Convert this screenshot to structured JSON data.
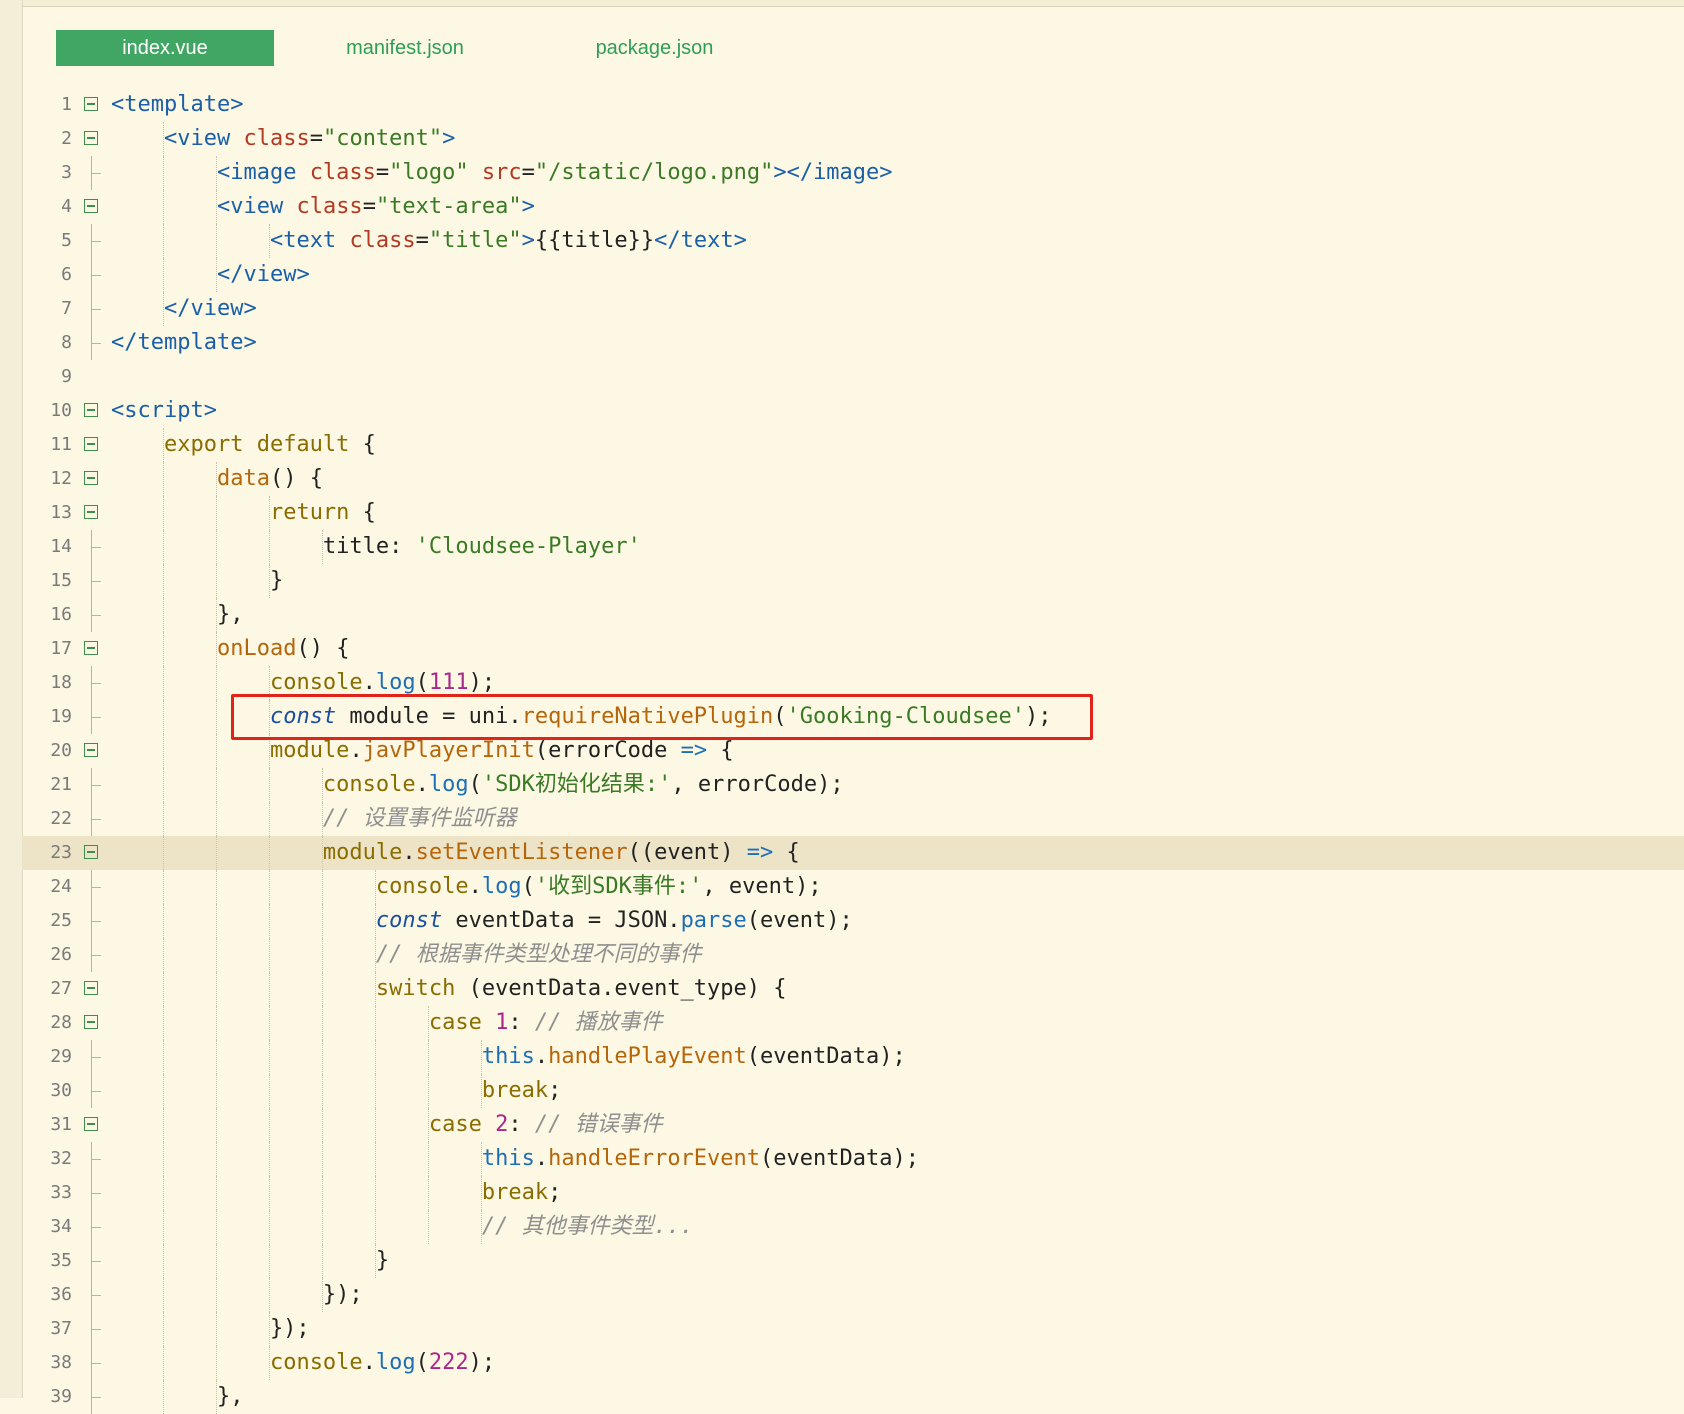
{
  "tabs": [
    {
      "label": "index.vue",
      "active": true
    },
    {
      "label": "manifest.json",
      "active": false
    },
    {
      "label": "package.json",
      "active": false
    }
  ],
  "current_line": 23,
  "highlighted_line": 19,
  "colors": {
    "accent": "#41a663",
    "highlight_box": "#e2231a",
    "background": "#fdf8e4"
  },
  "lines": [
    {
      "n": 1,
      "fold": true,
      "tokens": [
        {
          "c": "t",
          "v": "<template>"
        }
      ]
    },
    {
      "n": 2,
      "fold": true,
      "tokens": [
        {
          "c": "p",
          "v": "    "
        },
        {
          "c": "t",
          "v": "<view "
        },
        {
          "c": "a",
          "v": "class"
        },
        {
          "c": "p",
          "v": "="
        },
        {
          "c": "s",
          "v": "\"content\""
        },
        {
          "c": "t",
          "v": ">"
        }
      ]
    },
    {
      "n": 3,
      "fold": false,
      "tokens": [
        {
          "c": "p",
          "v": "        "
        },
        {
          "c": "t",
          "v": "<image "
        },
        {
          "c": "a",
          "v": "class"
        },
        {
          "c": "p",
          "v": "="
        },
        {
          "c": "s",
          "v": "\"logo\""
        },
        {
          "c": "p",
          "v": " "
        },
        {
          "c": "a",
          "v": "src"
        },
        {
          "c": "p",
          "v": "="
        },
        {
          "c": "s",
          "v": "\"/static/logo.png\""
        },
        {
          "c": "t",
          "v": "></image>"
        }
      ]
    },
    {
      "n": 4,
      "fold": true,
      "tokens": [
        {
          "c": "p",
          "v": "        "
        },
        {
          "c": "t",
          "v": "<view "
        },
        {
          "c": "a",
          "v": "class"
        },
        {
          "c": "p",
          "v": "="
        },
        {
          "c": "s",
          "v": "\"text-area\""
        },
        {
          "c": "t",
          "v": ">"
        }
      ]
    },
    {
      "n": 5,
      "fold": false,
      "tokens": [
        {
          "c": "p",
          "v": "            "
        },
        {
          "c": "t",
          "v": "<text "
        },
        {
          "c": "a",
          "v": "class"
        },
        {
          "c": "p",
          "v": "="
        },
        {
          "c": "s",
          "v": "\"title\""
        },
        {
          "c": "t",
          "v": ">"
        },
        {
          "c": "p",
          "v": "{{title}}"
        },
        {
          "c": "t",
          "v": "</text>"
        }
      ]
    },
    {
      "n": 6,
      "fold": false,
      "tokens": [
        {
          "c": "p",
          "v": "        "
        },
        {
          "c": "t",
          "v": "</view>"
        }
      ]
    },
    {
      "n": 7,
      "fold": false,
      "tokens": [
        {
          "c": "p",
          "v": "    "
        },
        {
          "c": "t",
          "v": "</view>"
        }
      ]
    },
    {
      "n": 8,
      "fold": false,
      "tokens": [
        {
          "c": "t",
          "v": "</template>"
        }
      ]
    },
    {
      "n": 9,
      "fold": false,
      "tokens": []
    },
    {
      "n": 10,
      "fold": true,
      "tokens": [
        {
          "c": "t",
          "v": "<script>"
        }
      ]
    },
    {
      "n": 11,
      "fold": true,
      "tokens": [
        {
          "c": "p",
          "v": "    "
        },
        {
          "c": "k",
          "v": "export default"
        },
        {
          "c": "p",
          "v": " {"
        }
      ]
    },
    {
      "n": 12,
      "fold": true,
      "tokens": [
        {
          "c": "p",
          "v": "        "
        },
        {
          "c": "fn",
          "v": "data"
        },
        {
          "c": "p",
          "v": "() {"
        }
      ]
    },
    {
      "n": 13,
      "fold": true,
      "tokens": [
        {
          "c": "p",
          "v": "            "
        },
        {
          "c": "k",
          "v": "return"
        },
        {
          "c": "p",
          "v": " {"
        }
      ]
    },
    {
      "n": 14,
      "fold": false,
      "tokens": [
        {
          "c": "p",
          "v": "                title: "
        },
        {
          "c": "s",
          "v": "'Cloudsee-Player'"
        }
      ]
    },
    {
      "n": 15,
      "fold": false,
      "tokens": [
        {
          "c": "p",
          "v": "            }"
        }
      ]
    },
    {
      "n": 16,
      "fold": false,
      "tokens": [
        {
          "c": "p",
          "v": "        },"
        }
      ]
    },
    {
      "n": 17,
      "fold": true,
      "tokens": [
        {
          "c": "p",
          "v": "        "
        },
        {
          "c": "fn",
          "v": "onLoad"
        },
        {
          "c": "p",
          "v": "() {"
        }
      ]
    },
    {
      "n": 18,
      "fold": false,
      "tokens": [
        {
          "c": "p",
          "v": "            "
        },
        {
          "c": "k",
          "v": "console"
        },
        {
          "c": "p",
          "v": "."
        },
        {
          "c": "m",
          "v": "log"
        },
        {
          "c": "p",
          "v": "("
        },
        {
          "c": "n",
          "v": "111"
        },
        {
          "c": "p",
          "v": ");"
        }
      ]
    },
    {
      "n": 19,
      "fold": false,
      "tokens": [
        {
          "c": "p",
          "v": "            "
        },
        {
          "c": "it",
          "v": "const"
        },
        {
          "c": "p",
          "v": " module = uni."
        },
        {
          "c": "fn",
          "v": "requireNativePlugin"
        },
        {
          "c": "p",
          "v": "("
        },
        {
          "c": "s",
          "v": "'Gooking-Cloudsee'"
        },
        {
          "c": "p",
          "v": ");"
        }
      ]
    },
    {
      "n": 20,
      "fold": true,
      "tokens": [
        {
          "c": "p",
          "v": "            "
        },
        {
          "c": "k",
          "v": "module"
        },
        {
          "c": "p",
          "v": "."
        },
        {
          "c": "fn",
          "v": "javPlayerInit"
        },
        {
          "c": "p",
          "v": "(errorCode "
        },
        {
          "c": "m",
          "v": "=>"
        },
        {
          "c": "p",
          "v": " {"
        }
      ]
    },
    {
      "n": 21,
      "fold": false,
      "tokens": [
        {
          "c": "p",
          "v": "                "
        },
        {
          "c": "k",
          "v": "console"
        },
        {
          "c": "p",
          "v": "."
        },
        {
          "c": "m",
          "v": "log"
        },
        {
          "c": "p",
          "v": "("
        },
        {
          "c": "s",
          "v": "'SDK初始化结果:'"
        },
        {
          "c": "p",
          "v": ", errorCode);"
        }
      ]
    },
    {
      "n": 22,
      "fold": false,
      "tokens": [
        {
          "c": "p",
          "v": "                "
        },
        {
          "c": "c",
          "v": "// 设置事件监听器"
        }
      ]
    },
    {
      "n": 23,
      "fold": true,
      "tokens": [
        {
          "c": "p",
          "v": "                "
        },
        {
          "c": "k",
          "v": "module"
        },
        {
          "c": "p",
          "v": "."
        },
        {
          "c": "fn",
          "v": "setEventListener"
        },
        {
          "c": "p",
          "v": "((event) "
        },
        {
          "c": "m",
          "v": "=>"
        },
        {
          "c": "p",
          "v": " {"
        }
      ]
    },
    {
      "n": 24,
      "fold": false,
      "tokens": [
        {
          "c": "p",
          "v": "                    "
        },
        {
          "c": "k",
          "v": "console"
        },
        {
          "c": "p",
          "v": "."
        },
        {
          "c": "m",
          "v": "log"
        },
        {
          "c": "p",
          "v": "("
        },
        {
          "c": "s",
          "v": "'收到SDK事件:'"
        },
        {
          "c": "p",
          "v": ", event);"
        }
      ]
    },
    {
      "n": 25,
      "fold": false,
      "tokens": [
        {
          "c": "p",
          "v": "                    "
        },
        {
          "c": "it",
          "v": "const"
        },
        {
          "c": "p",
          "v": " eventData = JSON."
        },
        {
          "c": "m",
          "v": "parse"
        },
        {
          "c": "p",
          "v": "(event);"
        }
      ]
    },
    {
      "n": 26,
      "fold": false,
      "tokens": [
        {
          "c": "p",
          "v": "                    "
        },
        {
          "c": "c",
          "v": "// 根据事件类型处理不同的事件"
        }
      ]
    },
    {
      "n": 27,
      "fold": true,
      "tokens": [
        {
          "c": "p",
          "v": "                    "
        },
        {
          "c": "k",
          "v": "switch"
        },
        {
          "c": "p",
          "v": " (eventData.event_type) {"
        }
      ]
    },
    {
      "n": 28,
      "fold": true,
      "tokens": [
        {
          "c": "p",
          "v": "                        "
        },
        {
          "c": "k",
          "v": "case"
        },
        {
          "c": "p",
          "v": " "
        },
        {
          "c": "n",
          "v": "1"
        },
        {
          "c": "p",
          "v": ": "
        },
        {
          "c": "c",
          "v": "// 播放事件"
        }
      ]
    },
    {
      "n": 29,
      "fold": false,
      "tokens": [
        {
          "c": "p",
          "v": "                            "
        },
        {
          "c": "m",
          "v": "this"
        },
        {
          "c": "p",
          "v": "."
        },
        {
          "c": "fn",
          "v": "handlePlayEvent"
        },
        {
          "c": "p",
          "v": "(eventData);"
        }
      ]
    },
    {
      "n": 30,
      "fold": false,
      "tokens": [
        {
          "c": "p",
          "v": "                            "
        },
        {
          "c": "k",
          "v": "break"
        },
        {
          "c": "p",
          "v": ";"
        }
      ]
    },
    {
      "n": 31,
      "fold": true,
      "tokens": [
        {
          "c": "p",
          "v": "                        "
        },
        {
          "c": "k",
          "v": "case"
        },
        {
          "c": "p",
          "v": " "
        },
        {
          "c": "n",
          "v": "2"
        },
        {
          "c": "p",
          "v": ": "
        },
        {
          "c": "c",
          "v": "// 错误事件"
        }
      ]
    },
    {
      "n": 32,
      "fold": false,
      "tokens": [
        {
          "c": "p",
          "v": "                            "
        },
        {
          "c": "m",
          "v": "this"
        },
        {
          "c": "p",
          "v": "."
        },
        {
          "c": "fn",
          "v": "handleErrorEvent"
        },
        {
          "c": "p",
          "v": "(eventData);"
        }
      ]
    },
    {
      "n": 33,
      "fold": false,
      "tokens": [
        {
          "c": "p",
          "v": "                            "
        },
        {
          "c": "k",
          "v": "break"
        },
        {
          "c": "p",
          "v": ";"
        }
      ]
    },
    {
      "n": 34,
      "fold": false,
      "tokens": [
        {
          "c": "p",
          "v": "                            "
        },
        {
          "c": "c",
          "v": "// 其他事件类型..."
        }
      ]
    },
    {
      "n": 35,
      "fold": false,
      "tokens": [
        {
          "c": "p",
          "v": "                    }"
        }
      ]
    },
    {
      "n": 36,
      "fold": false,
      "tokens": [
        {
          "c": "p",
          "v": "                });"
        }
      ]
    },
    {
      "n": 37,
      "fold": false,
      "tokens": [
        {
          "c": "p",
          "v": "            });"
        }
      ]
    },
    {
      "n": 38,
      "fold": false,
      "tokens": [
        {
          "c": "p",
          "v": "            "
        },
        {
          "c": "k",
          "v": "console"
        },
        {
          "c": "p",
          "v": "."
        },
        {
          "c": "m",
          "v": "log"
        },
        {
          "c": "p",
          "v": "("
        },
        {
          "c": "n",
          "v": "222"
        },
        {
          "c": "p",
          "v": ");"
        }
      ]
    },
    {
      "n": 39,
      "fold": false,
      "tokens": [
        {
          "c": "p",
          "v": "        },"
        }
      ]
    }
  ]
}
